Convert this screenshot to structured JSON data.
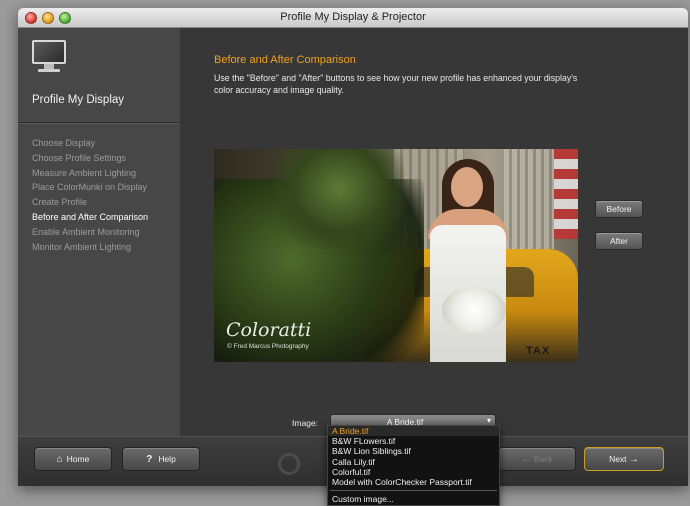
{
  "window": {
    "title": "Profile My Display & Projector"
  },
  "sidebar": {
    "title": "Profile My Display",
    "steps": [
      {
        "label": "Choose Display",
        "active": false
      },
      {
        "label": "Choose Profile Settings",
        "active": false
      },
      {
        "label": "Measure Ambient Lighting",
        "active": false
      },
      {
        "label": "Place ColorMunki on Display",
        "active": false
      },
      {
        "label": "Create Profile",
        "active": false
      },
      {
        "label": "Before and After Comparison",
        "active": true
      },
      {
        "label": "Enable Ambient Monitoring",
        "active": false
      },
      {
        "label": "Monitor Ambient Lighting",
        "active": false
      }
    ]
  },
  "main": {
    "heading": "Before and After Comparison",
    "description": "Use the \"Before\" and \"After\" buttons to see how your new profile has enhanced your display's color accuracy and image quality.",
    "photo": {
      "watermark": "Coloratti",
      "credit": "© Fred Marcus Photography",
      "taxi_text": "TAX"
    },
    "before_label": "Before",
    "after_label": "After",
    "image_label": "Image:",
    "image_select_value": "A Bride.tif",
    "image_options": [
      "A Bride.tif",
      "B&W FLowers.tif",
      "B&W Lion Siblings.tif",
      "Calla Lily.tif",
      "Colorful.tif",
      "Model with ColorChecker Passport.tif"
    ],
    "custom_option": "Custom image..."
  },
  "footer": {
    "home_label": "Home",
    "help_label": "Help",
    "back_label": "Back",
    "next_label": "Next"
  },
  "colors": {
    "accent": "#f0a020",
    "sidebar_bg": "#474747",
    "main_bg": "#373737"
  }
}
